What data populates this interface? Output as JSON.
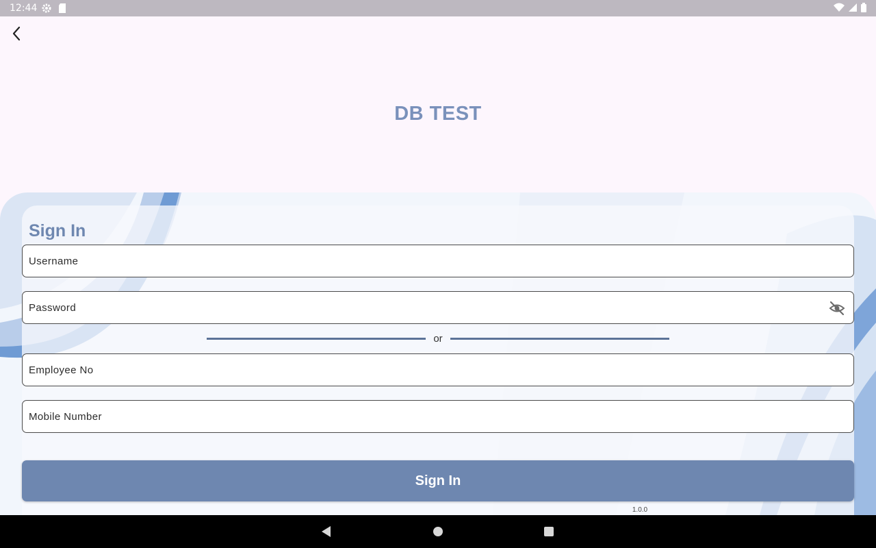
{
  "status_bar": {
    "time": "12:44",
    "left_icons": [
      "gear-icon",
      "sd-card-icon"
    ],
    "right_icons": [
      "wifi-icon",
      "signal-icon",
      "battery-icon"
    ]
  },
  "app_bar": {
    "title": "DB TEST",
    "back_icon": "chevron-left-icon"
  },
  "form": {
    "heading": "Sign In",
    "username": {
      "placeholder": "Username",
      "value": ""
    },
    "password": {
      "placeholder": "Password",
      "value": "",
      "toggle_icon": "eye-off-icon"
    },
    "divider_text": "or",
    "employee_no": {
      "placeholder": "Employee No",
      "value": ""
    },
    "mobile_number": {
      "placeholder": "Mobile Number",
      "value": ""
    },
    "submit_label": "Sign In",
    "version": "1.0.0"
  },
  "nav_bar": {
    "buttons": [
      "back-triangle-icon",
      "home-circle-icon",
      "recents-square-icon"
    ]
  },
  "colors": {
    "accent": "#6e87b0",
    "title": "#7a91bb",
    "background": "#fdf6fd",
    "status_bar": "#bdb8c0"
  }
}
